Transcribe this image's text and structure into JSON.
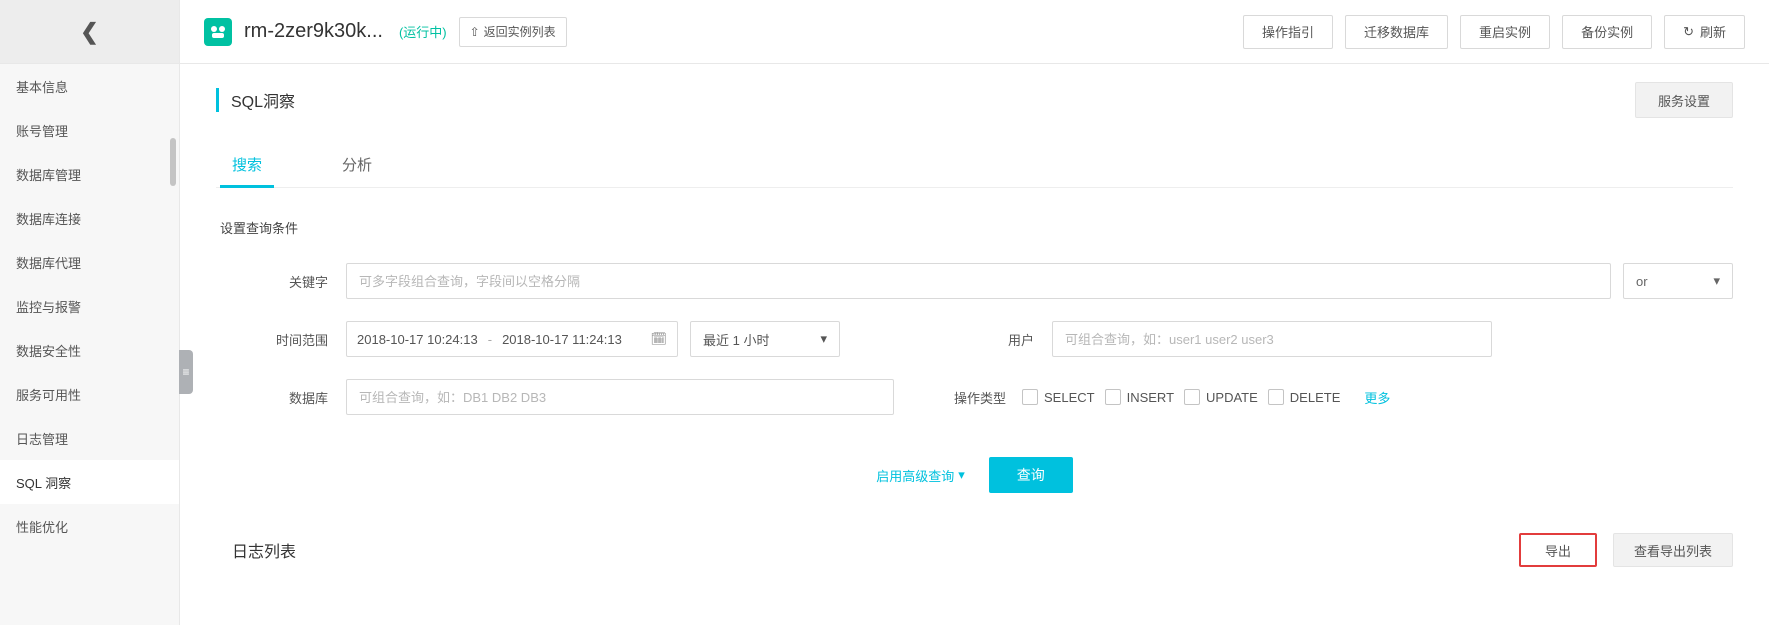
{
  "sidebar": {
    "items": [
      {
        "label": "基本信息"
      },
      {
        "label": "账号管理"
      },
      {
        "label": "数据库管理"
      },
      {
        "label": "数据库连接"
      },
      {
        "label": "数据库代理"
      },
      {
        "label": "监控与报警"
      },
      {
        "label": "数据安全性"
      },
      {
        "label": "服务可用性"
      },
      {
        "label": "日志管理"
      },
      {
        "label": "SQL 洞察"
      },
      {
        "label": "性能优化"
      }
    ],
    "active_index": 9
  },
  "header": {
    "instance_name": "rm-2zer9k30k...",
    "status": "(运行中)",
    "back_label": "返回实例列表",
    "buttons": {
      "guide": "操作指引",
      "migrate": "迁移数据库",
      "restart": "重启实例",
      "backup": "备份实例",
      "refresh": "刷新"
    }
  },
  "section": {
    "title": "SQL洞察",
    "service_settings": "服务设置"
  },
  "tabs": [
    {
      "label": "搜索",
      "active": true
    },
    {
      "label": "分析",
      "active": false
    }
  ],
  "conditions": {
    "heading": "设置查询条件",
    "keyword": {
      "label": "关键字",
      "placeholder": "可多字段组合查询，字段间以空格分隔",
      "op": "or"
    },
    "time": {
      "label": "时间范围",
      "from": "2018-10-17 10:24:13",
      "to": "2018-10-17 11:24:13",
      "recent": "最近 1 小时"
    },
    "user": {
      "label": "用户",
      "placeholder": "可组合查询，如：user1 user2 user3"
    },
    "db": {
      "label": "数据库",
      "placeholder": "可组合查询，如：DB1 DB2 DB3"
    },
    "optype": {
      "label": "操作类型",
      "options": [
        "SELECT",
        "INSERT",
        "UPDATE",
        "DELETE"
      ],
      "more": "更多"
    },
    "advanced": "启用高级查询",
    "query": "查询"
  },
  "loglist": {
    "title": "日志列表",
    "export": "导出",
    "view_exports": "查看导出列表"
  }
}
